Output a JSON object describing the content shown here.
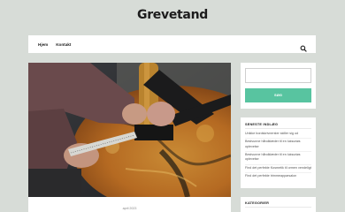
{
  "site": {
    "title": "Grevetand"
  },
  "nav": {
    "items": [
      {
        "label": "Hjem"
      },
      {
        "label": "Kontakt"
      }
    ],
    "search_icon": "search-icon"
  },
  "hero": {
    "image_description_icon": "photo"
  },
  "post": {
    "date": "april 2023"
  },
  "sidebar": {
    "search": {
      "placeholder": "",
      "button_label": "SØG"
    },
    "recent": {
      "heading": "SENESTE INDLÆG",
      "items": [
        {
          "label": "Unikke bordskrivnerster skiller sig ud"
        },
        {
          "label": "Bestvunne håndklæder til en luksuriøs oplevelse"
        },
        {
          "label": "Bestvunne håndklæder til en luksuriøs oplevelse"
        },
        {
          "label": "Find det perfekte Kosmetik til ormen vendeligt"
        },
        {
          "label": "Find det perfekte trimmeapparsalon"
        }
      ]
    },
    "categories": {
      "heading": "KATEGORIER"
    }
  },
  "colors": {
    "accent": "#58c4a0",
    "background": "#d7dcd7"
  }
}
